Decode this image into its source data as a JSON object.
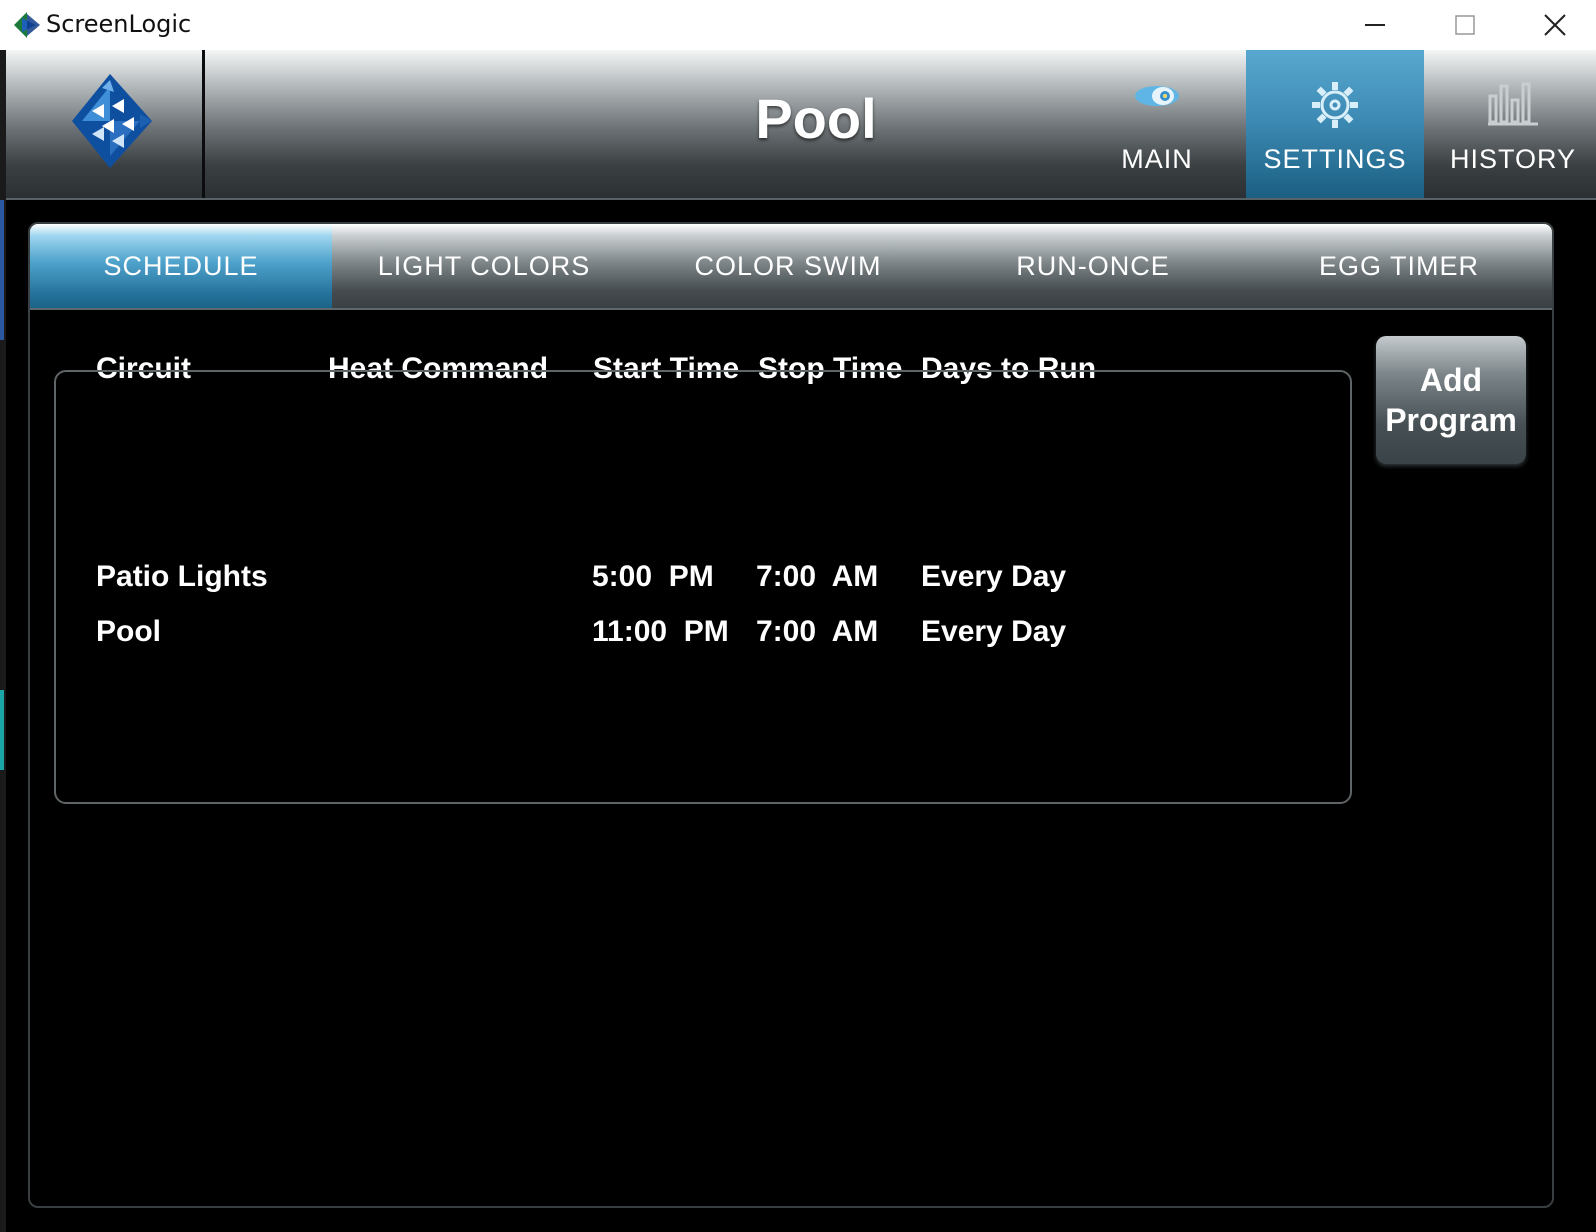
{
  "window": {
    "title": "ScreenLogic",
    "icon": "screenlogic-app-icon",
    "controls": [
      "minimize-icon",
      "maximize-icon",
      "close-icon"
    ]
  },
  "header": {
    "title": "Pool",
    "logo": "pentair-logo-icon",
    "nav": [
      {
        "label": "MAIN",
        "icon": "pool-light-icon",
        "active": false
      },
      {
        "label": "SETTINGS",
        "icon": "gear-icon",
        "active": true
      },
      {
        "label": "HISTORY",
        "icon": "bar-chart-icon",
        "active": false
      }
    ]
  },
  "tabs": [
    {
      "label": "SCHEDULE",
      "active": true
    },
    {
      "label": "LIGHT COLORS",
      "active": false
    },
    {
      "label": "COLOR SWIM",
      "active": false
    },
    {
      "label": "RUN-ONCE",
      "active": false
    },
    {
      "label": "EGG TIMER",
      "active": false
    }
  ],
  "schedule": {
    "columns": [
      "Circuit",
      "Heat Command",
      "Start Time",
      "Stop Time",
      "Days to Run"
    ],
    "rows": [
      {
        "circuit": "Patio Lights",
        "heat_command": "",
        "start_time": "5:00  PM",
        "stop_time": "7:00  AM",
        "days": "Every Day"
      },
      {
        "circuit": "Pool",
        "heat_command": "",
        "start_time": "11:00  PM",
        "stop_time": "7:00  AM",
        "days": "Every Day"
      }
    ],
    "add_button": "Add\nProgram"
  },
  "colors": {
    "accent_active": "#3e8cb6",
    "background": "#000000",
    "text": "#ffffff"
  }
}
